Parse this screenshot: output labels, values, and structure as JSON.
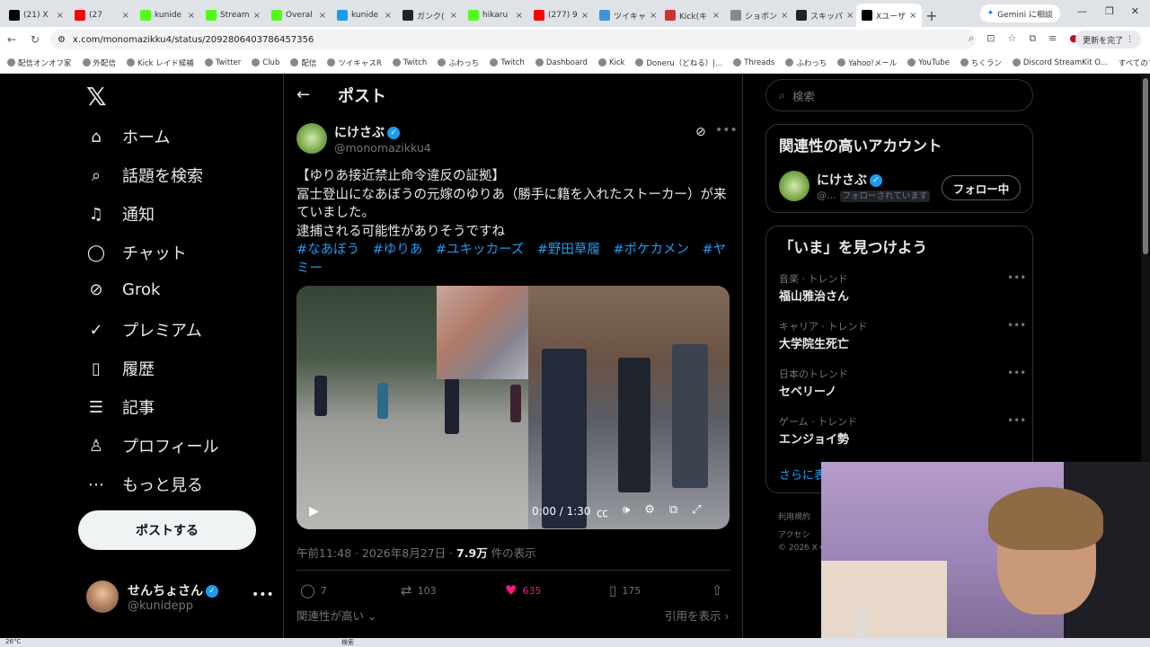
{
  "browser": {
    "tabs": [
      {
        "label": "(21) X",
        "color": "#000000"
      },
      {
        "label": "(27",
        "color": "#ff0000"
      },
      {
        "label": "kunide",
        "color": "#53fc18"
      },
      {
        "label": "Stream",
        "color": "#53fc18"
      },
      {
        "label": "Overal",
        "color": "#53fc18"
      },
      {
        "label": "kunide",
        "color": "#1d9bf0"
      },
      {
        "label": "ガンク(",
        "color": "#222222"
      },
      {
        "label": "hikaru",
        "color": "#53fc18"
      },
      {
        "label": "(277) 9",
        "color": "#ff0000"
      },
      {
        "label": "ツイキャ",
        "color": "#3a96dd"
      },
      {
        "label": "Kick(キ",
        "color": "#cc3333"
      },
      {
        "label": "ショボン",
        "color": "#888888"
      },
      {
        "label": "スキッパ",
        "color": "#222222"
      },
      {
        "label": "Xユーザ",
        "color": "#000000"
      }
    ],
    "gemini_label": "Gemini に相談",
    "url": "x.com/monomazikku4/status/2092806403786457356",
    "update_label": "更新を完了",
    "bookmarks": [
      "配信オンオフ家",
      "外配信",
      "Kick レイド候補",
      "Twitter",
      "Club",
      "配信",
      "ツイキャスR",
      "Twitch",
      "ふわっち",
      "Twitch",
      "Dashboard",
      "Kick",
      "Doneru（どねる）|...",
      "Threads",
      "ふわっち",
      "Yahoo!メール",
      "YouTube",
      "ちくラン",
      "Discord StreamKit O..."
    ],
    "bookmarks_folder": "すべてのブックマーク"
  },
  "nav": {
    "items": [
      {
        "label": "ホーム",
        "icon": "home-icon",
        "glyph": "⌂"
      },
      {
        "label": "話題を検索",
        "icon": "search-icon",
        "glyph": "⌕"
      },
      {
        "label": "通知",
        "icon": "bell-icon",
        "glyph": "♫"
      },
      {
        "label": "チャット",
        "icon": "chat-icon",
        "glyph": "◯"
      },
      {
        "label": "Grok",
        "icon": "grok-icon",
        "glyph": "⊘"
      },
      {
        "label": "プレミアム",
        "icon": "premium-icon",
        "glyph": "✓"
      },
      {
        "label": "履歴",
        "icon": "bookmark-icon",
        "glyph": "▯"
      },
      {
        "label": "記事",
        "icon": "article-icon",
        "glyph": "☰"
      },
      {
        "label": "プロフィール",
        "icon": "profile-icon",
        "glyph": "♙"
      },
      {
        "label": "もっと見る",
        "icon": "more-icon",
        "glyph": "⋯"
      }
    ],
    "post_button": "ポストする",
    "user": {
      "name": "せんちょさん",
      "handle": "@kunidepp"
    }
  },
  "post": {
    "header_title": "ポスト",
    "author_name": "にけさぶ",
    "author_handle": "@monomazikku4",
    "lines": [
      "【ゆりあ接近禁止命令違反の証拠】",
      "冨士登山になあぼうの元嫁のゆりあ（勝手に籍を入れたストーカー）が来ていました。",
      "逮捕される可能性がありそうですね"
    ],
    "hashtags": "#なあぼう　#ゆりあ　#ユキッカーズ　#野田草履　#ポケカメン　#ヤミー",
    "video_time": "0:00 / 1:30",
    "timestamp": "午前11:48 · 2026年8月27日 · ",
    "views_count": "7.9万",
    "views_label": " 件の表示",
    "replies": "7",
    "reposts": "103",
    "likes": "635",
    "bookmarks": "175",
    "relevance": "関連性が高い",
    "quotes": "引用を表示"
  },
  "sidebar": {
    "search_placeholder": "検索",
    "related_title": "関連性の高いアカウント",
    "related_name": "にけさぶ",
    "related_handle": "@...",
    "related_badge": "フォローされています",
    "follow_label": "フォロー中",
    "trends_title": "「いま」を見つけよう",
    "trends": [
      {
        "category": "音楽 · トレンド",
        "name": "福山雅治さん"
      },
      {
        "category": "キャリア · トレンド",
        "name": "大学院生死亡"
      },
      {
        "category": "日本のトレンド",
        "name": "セベリーノ"
      },
      {
        "category": "ゲーム · トレンド",
        "name": "エンジョイ勢"
      }
    ],
    "show_more": "さらに表",
    "footer": [
      "利用規約",
      "アクセシ",
      "© 2026 X C"
    ]
  },
  "system": {
    "temperature": "26°C",
    "taskbar_search": "検索"
  }
}
